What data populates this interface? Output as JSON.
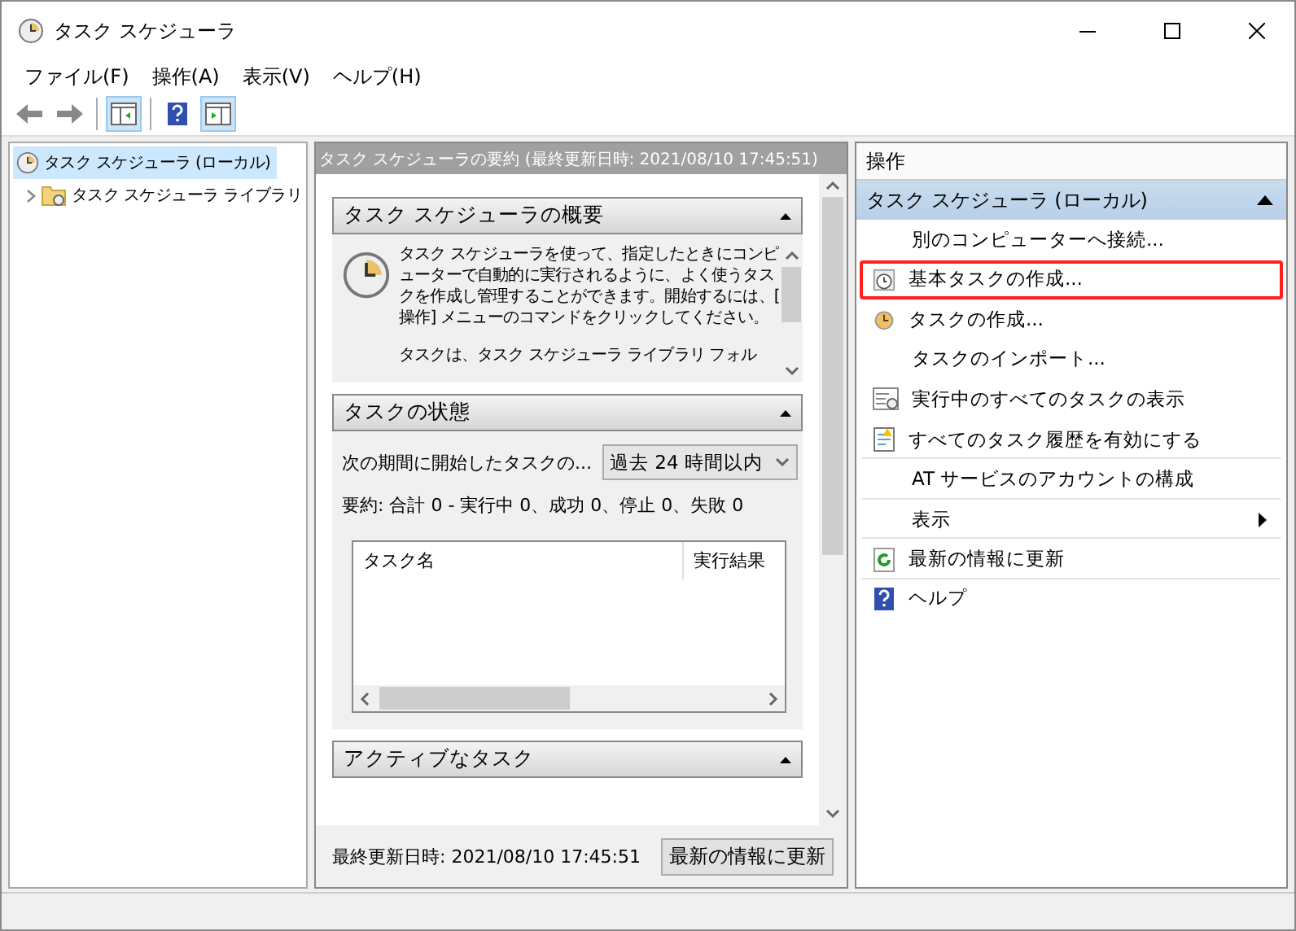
{
  "window": {
    "title": "タスク スケジューラ"
  },
  "menu": [
    "ファイル(F)",
    "操作(A)",
    "表示(V)",
    "ヘルプ(H)"
  ],
  "toolbar": [
    {
      "kind": "back",
      "selected": false
    },
    {
      "kind": "forward",
      "selected": false
    },
    {
      "kind": "sep"
    },
    {
      "kind": "console-tree",
      "selected": true
    },
    {
      "kind": "sep"
    },
    {
      "kind": "help",
      "selected": false
    },
    {
      "kind": "action-pane",
      "selected": true
    }
  ],
  "tree": [
    {
      "label": "タスク スケジューラ (ローカル)",
      "selected": true,
      "children": [
        {
          "label": "タスク スケジューラ ライブラリ",
          "selected": false,
          "expanded": false
        }
      ]
    }
  ],
  "center": {
    "title": "タスク スケジューラの要約 (最終更新日時: 2021/08/10 17:45:51)",
    "sections": [
      {
        "kind": "overview",
        "title": "タスク スケジューラの概要",
        "paragraphs": [
          "タスク スケジューラを使って、指定したときにコンピューターで自動的に実行されるように、よく使うタスクを作成し管理することができます。開始するには、[操作] メニューのコマンドをクリックしてください。",
          "タスクは、タスク スケジューラ ライブラリ フォル"
        ]
      },
      {
        "kind": "status",
        "title": "タスクの状態",
        "filter_label": "次の期間に開始したタスクの...",
        "filter_value": "過去 24 時間以内",
        "summary": "要約: 合計 0 - 実行中 0、成功 0、停止 0、失敗 0",
        "columns": [
          "タスク名",
          "実行結果"
        ]
      },
      {
        "kind": "header",
        "title": "アクティブなタスク"
      }
    ],
    "footer": {
      "text": "最終更新日時: 2021/08/10 17:45:51",
      "button": "最新の情報に更新"
    }
  },
  "actions": {
    "title": "操作",
    "group": "タスク スケジューラ (ローカル)",
    "items": [
      {
        "label": "別のコンピューターへ接続...",
        "kind": "plain",
        "highlighted": false,
        "submenu": false,
        "divider": false
      },
      {
        "label": "基本タスクの作成...",
        "kind": "basic-task",
        "highlighted": true,
        "submenu": false,
        "divider": false
      },
      {
        "label": "タスクの作成...",
        "kind": "task",
        "highlighted": false,
        "submenu": false,
        "divider": false
      },
      {
        "label": "タスクのインポート...",
        "kind": "plain",
        "highlighted": false,
        "submenu": false,
        "divider": false
      },
      {
        "label": "実行中のすべてのタスクの表示",
        "kind": "running",
        "highlighted": false,
        "submenu": false,
        "divider": false
      },
      {
        "label": "すべてのタスク履歴を有効にする",
        "kind": "history",
        "highlighted": false,
        "submenu": false,
        "divider": true
      },
      {
        "label": "AT サービスのアカウントの構成",
        "kind": "plain",
        "highlighted": false,
        "submenu": false,
        "divider": true
      },
      {
        "label": "表示",
        "kind": "plain",
        "highlighted": false,
        "submenu": true,
        "divider": true
      },
      {
        "label": "最新の情報に更新",
        "kind": "refresh",
        "highlighted": false,
        "submenu": false,
        "divider": true
      },
      {
        "label": "ヘルプ",
        "kind": "help",
        "highlighted": false,
        "submenu": false,
        "divider": false
      }
    ]
  }
}
